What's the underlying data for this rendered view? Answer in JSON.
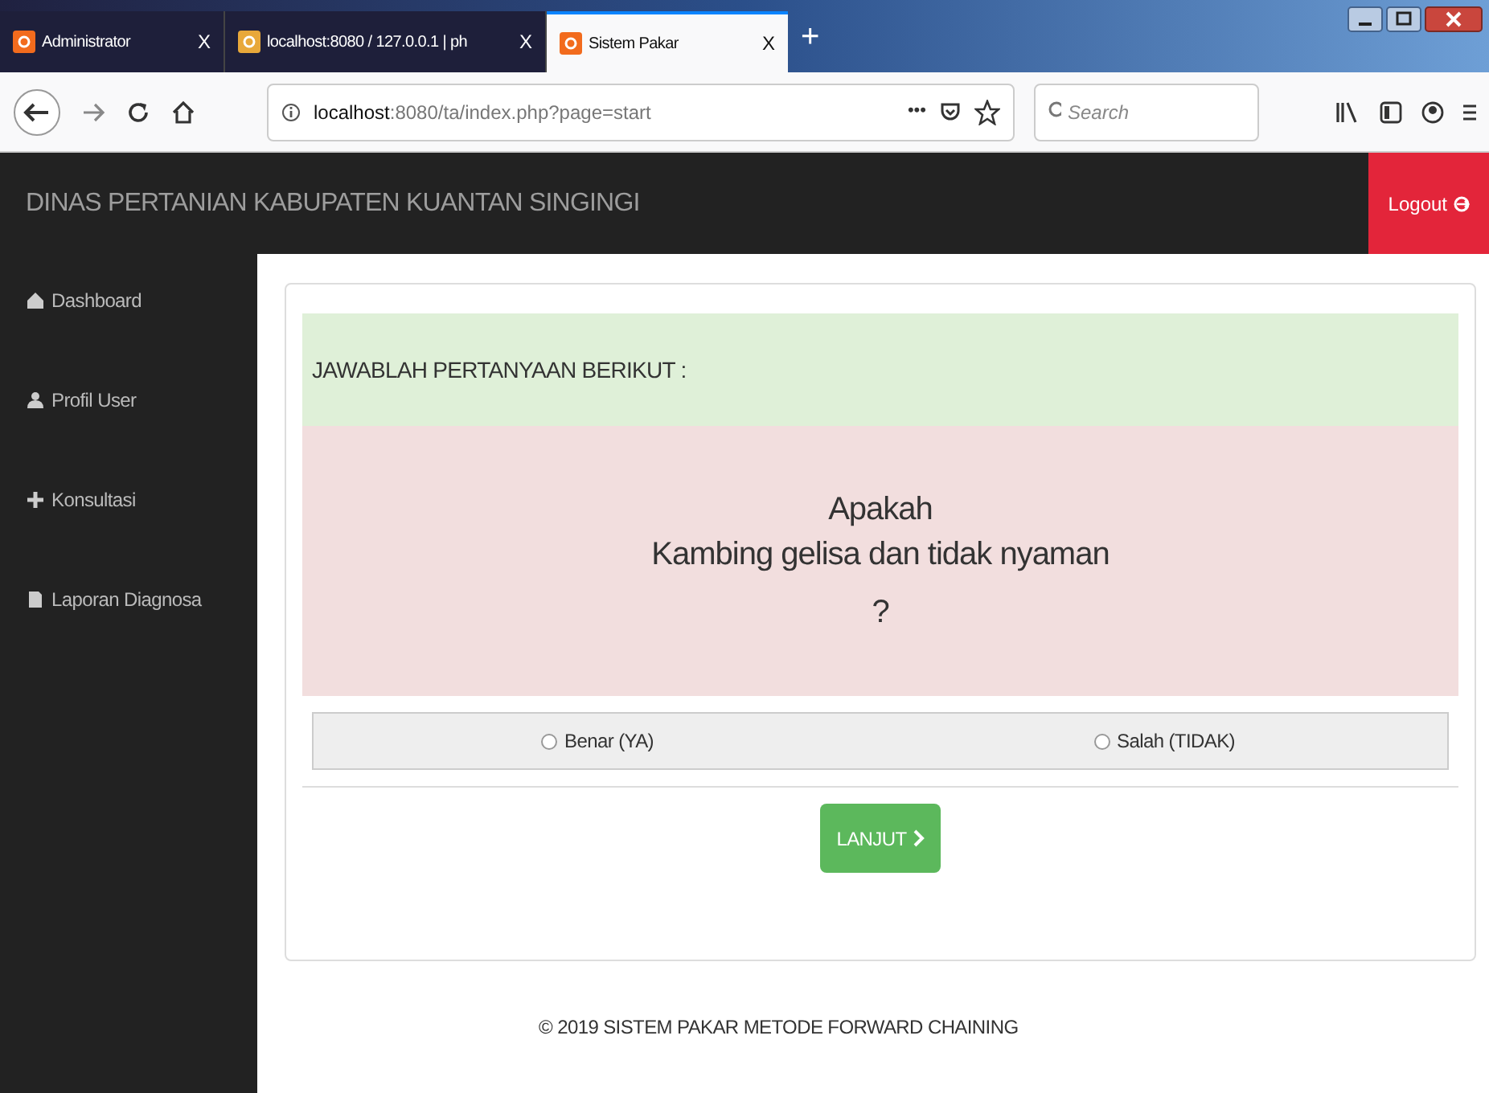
{
  "browser": {
    "tabs": [
      {
        "title": "Administrator",
        "close": "X",
        "selected": false
      },
      {
        "title": "localhost:8080 / 127.0.0.1 | ph",
        "close": "X",
        "selected": false
      },
      {
        "title": "Sistem Pakar",
        "close": "X",
        "selected": true
      }
    ],
    "new_tab": "+",
    "url_host": "localhost",
    "url_rest": ":8080/ta/index.php?page=start",
    "more": "•••",
    "search_placeholder": "Search"
  },
  "navbar": {
    "brand": "DINAS PERTANIAN KABUPATEN KUANTAN SINGINGI",
    "logout": "Logout"
  },
  "sidebar": {
    "items": [
      {
        "label": "Dashboard"
      },
      {
        "label": "Profil User"
      },
      {
        "label": "Konsultasi"
      },
      {
        "label": "Laporan Diagnosa"
      }
    ]
  },
  "panel": {
    "heading": "JAWABLAH PERTANYAAN BERIKUT :",
    "question_prefix": "Apakah",
    "question": "Kambing gelisa dan tidak nyaman",
    "question_suffix": "?",
    "options": [
      {
        "label": "Benar (YA)",
        "selected": false
      },
      {
        "label": "Salah (TIDAK)",
        "selected": false
      }
    ],
    "button": "LANJUT"
  },
  "footer": "© 2019 SISTEM PAKAR METODE FORWARD CHAINING"
}
